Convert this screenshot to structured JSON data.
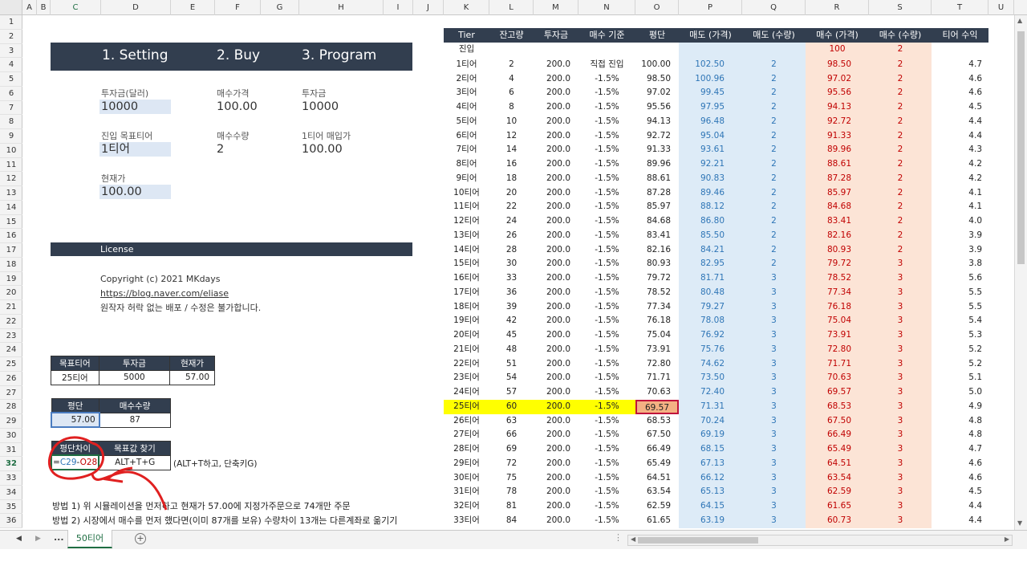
{
  "col_headers": [
    "A",
    "B",
    "C",
    "D",
    "E",
    "F",
    "G",
    "H",
    "I",
    "J",
    "K",
    "L",
    "M",
    "N",
    "O",
    "P",
    "Q",
    "R",
    "S",
    "T",
    "U"
  ],
  "row_headers": [
    "1",
    "2",
    "3",
    "4",
    "5",
    "6",
    "7",
    "8",
    "9",
    "10",
    "11",
    "12",
    "13",
    "14",
    "15",
    "16",
    "17",
    "18",
    "19",
    "20",
    "21",
    "22",
    "23",
    "24",
    "25",
    "26",
    "27",
    "28",
    "29",
    "30",
    "31",
    "32",
    "33",
    "34",
    "35",
    "36"
  ],
  "setting_panel": {
    "title1": "1. Setting",
    "title2": "2. Buy",
    "title3": "3. Program",
    "invest_label": "투자금(달러)",
    "invest_value": "10000",
    "entry_tier_label": "진입 목표티어",
    "entry_tier_value": "1티어",
    "current_label": "현재가",
    "current_value": "100.00",
    "buy_price_label": "매수가격",
    "buy_price_value": "100.00",
    "buy_qty_label": "매수수량",
    "buy_qty_value": "2",
    "prog_invest_label": "투자금",
    "prog_invest_value": "10000",
    "tier1_buy_label": "1티어 매입가",
    "tier1_buy_value": "100.00"
  },
  "license_panel": {
    "title": "License",
    "copyright": "Copyright (c) 2021 MKdays",
    "url": "https://blog.naver.com/eliase",
    "note": "원작자 허락 없는 배포 / 수정은 불가합니다."
  },
  "target_table": {
    "headers": [
      "목표티어",
      "투자금",
      "현재가"
    ],
    "values": [
      "25티어",
      "5000",
      "57.00"
    ]
  },
  "avg_table": {
    "headers": [
      "평단",
      "매수수량"
    ],
    "values": [
      "57.00",
      "87"
    ]
  },
  "diff_table": {
    "headers": [
      "평단차이",
      "목표값 찾기"
    ],
    "formula": "=C29-O28",
    "shortcut": "ALT+T+G",
    "note": "(ALT+T하고, 단축키G)"
  },
  "methods": {
    "m1": "방법 1) 위 시뮬레이션을 먼저하고 현재가 57.00에 지정가주문으로 74개만 주문",
    "m2": "방법 2) 시장에서 매수를 먼저 했다면(이미 87개를 보유) 수량차이 13개는 다른계좌로 옮기기"
  },
  "tier_table": {
    "headers": [
      "Tier",
      "잔고량",
      "투자금",
      "매수 기준",
      "평단",
      "매도 (가격)",
      "매도 (수량)",
      "매수 (가격)",
      "매수 (수량)",
      "티어 수익"
    ],
    "entry_row": {
      "tier": "진입",
      "buy_price": "100",
      "buy_qty": "2"
    },
    "rows": [
      [
        "1티어",
        "2",
        "200.0",
        "직접 진입",
        "100.00",
        "102.50",
        "2",
        "98.50",
        "2",
        "4.7"
      ],
      [
        "2티어",
        "4",
        "200.0",
        "-1.5%",
        "98.50",
        "100.96",
        "2",
        "97.02",
        "2",
        "4.6"
      ],
      [
        "3티어",
        "6",
        "200.0",
        "-1.5%",
        "97.02",
        "99.45",
        "2",
        "95.56",
        "2",
        "4.6"
      ],
      [
        "4티어",
        "8",
        "200.0",
        "-1.5%",
        "95.56",
        "97.95",
        "2",
        "94.13",
        "2",
        "4.5"
      ],
      [
        "5티어",
        "10",
        "200.0",
        "-1.5%",
        "94.13",
        "96.48",
        "2",
        "92.72",
        "2",
        "4.4"
      ],
      [
        "6티어",
        "12",
        "200.0",
        "-1.5%",
        "92.72",
        "95.04",
        "2",
        "91.33",
        "2",
        "4.4"
      ],
      [
        "7티어",
        "14",
        "200.0",
        "-1.5%",
        "91.33",
        "93.61",
        "2",
        "89.96",
        "2",
        "4.3"
      ],
      [
        "8티어",
        "16",
        "200.0",
        "-1.5%",
        "89.96",
        "92.21",
        "2",
        "88.61",
        "2",
        "4.2"
      ],
      [
        "9티어",
        "18",
        "200.0",
        "-1.5%",
        "88.61",
        "90.83",
        "2",
        "87.28",
        "2",
        "4.2"
      ],
      [
        "10티어",
        "20",
        "200.0",
        "-1.5%",
        "87.28",
        "89.46",
        "2",
        "85.97",
        "2",
        "4.1"
      ],
      [
        "11티어",
        "22",
        "200.0",
        "-1.5%",
        "85.97",
        "88.12",
        "2",
        "84.68",
        "2",
        "4.1"
      ],
      [
        "12티어",
        "24",
        "200.0",
        "-1.5%",
        "84.68",
        "86.80",
        "2",
        "83.41",
        "2",
        "4.0"
      ],
      [
        "13티어",
        "26",
        "200.0",
        "-1.5%",
        "83.41",
        "85.50",
        "2",
        "82.16",
        "2",
        "3.9"
      ],
      [
        "14티어",
        "28",
        "200.0",
        "-1.5%",
        "82.16",
        "84.21",
        "2",
        "80.93",
        "2",
        "3.9"
      ],
      [
        "15티어",
        "30",
        "200.0",
        "-1.5%",
        "80.93",
        "82.95",
        "2",
        "79.72",
        "3",
        "3.8"
      ],
      [
        "16티어",
        "33",
        "200.0",
        "-1.5%",
        "79.72",
        "81.71",
        "3",
        "78.52",
        "3",
        "5.6"
      ],
      [
        "17티어",
        "36",
        "200.0",
        "-1.5%",
        "78.52",
        "80.48",
        "3",
        "77.34",
        "3",
        "5.5"
      ],
      [
        "18티어",
        "39",
        "200.0",
        "-1.5%",
        "77.34",
        "79.27",
        "3",
        "76.18",
        "3",
        "5.5"
      ],
      [
        "19티어",
        "42",
        "200.0",
        "-1.5%",
        "76.18",
        "78.08",
        "3",
        "75.04",
        "3",
        "5.4"
      ],
      [
        "20티어",
        "45",
        "200.0",
        "-1.5%",
        "75.04",
        "76.92",
        "3",
        "73.91",
        "3",
        "5.3"
      ],
      [
        "21티어",
        "48",
        "200.0",
        "-1.5%",
        "73.91",
        "75.76",
        "3",
        "72.80",
        "3",
        "5.2"
      ],
      [
        "22티어",
        "51",
        "200.0",
        "-1.5%",
        "72.80",
        "74.62",
        "3",
        "71.71",
        "3",
        "5.2"
      ],
      [
        "23티어",
        "54",
        "200.0",
        "-1.5%",
        "71.71",
        "73.50",
        "3",
        "70.63",
        "3",
        "5.1"
      ],
      [
        "24티어",
        "57",
        "200.0",
        "-1.5%",
        "70.63",
        "72.40",
        "3",
        "69.57",
        "3",
        "5.0"
      ],
      [
        "25티어",
        "60",
        "200.0",
        "-1.5%",
        "69.57",
        "71.31",
        "3",
        "68.53",
        "3",
        "4.9"
      ],
      [
        "26티어",
        "63",
        "200.0",
        "-1.5%",
        "68.53",
        "70.24",
        "3",
        "67.50",
        "3",
        "4.8"
      ],
      [
        "27티어",
        "66",
        "200.0",
        "-1.5%",
        "67.50",
        "69.19",
        "3",
        "66.49",
        "3",
        "4.8"
      ],
      [
        "28티어",
        "69",
        "200.0",
        "-1.5%",
        "66.49",
        "68.15",
        "3",
        "65.49",
        "3",
        "4.7"
      ],
      [
        "29티어",
        "72",
        "200.0",
        "-1.5%",
        "65.49",
        "67.13",
        "3",
        "64.51",
        "3",
        "4.6"
      ],
      [
        "30티어",
        "75",
        "200.0",
        "-1.5%",
        "64.51",
        "66.12",
        "3",
        "63.54",
        "3",
        "4.6"
      ],
      [
        "31티어",
        "78",
        "200.0",
        "-1.5%",
        "63.54",
        "65.13",
        "3",
        "62.59",
        "3",
        "4.5"
      ],
      [
        "32티어",
        "81",
        "200.0",
        "-1.5%",
        "62.59",
        "64.15",
        "3",
        "61.65",
        "3",
        "4.4"
      ],
      [
        "33티어",
        "84",
        "200.0",
        "-1.5%",
        "61.65",
        "63.19",
        "3",
        "60.73",
        "3",
        "4.4"
      ]
    ],
    "highlight_tier": "25티어"
  },
  "sheet_tab": "50티어",
  "tab_nav": {
    "prev": "◀",
    "next": "▶",
    "more": "...",
    "add": "+"
  },
  "colors": {
    "dark": "#323e4f",
    "sell_bg": "#ddebf7",
    "sell_text": "#2e75b6",
    "buy_bg": "#fce4d6",
    "buy_text": "#c00000",
    "highlight": "#ffff00",
    "annotation": "#e02020"
  }
}
